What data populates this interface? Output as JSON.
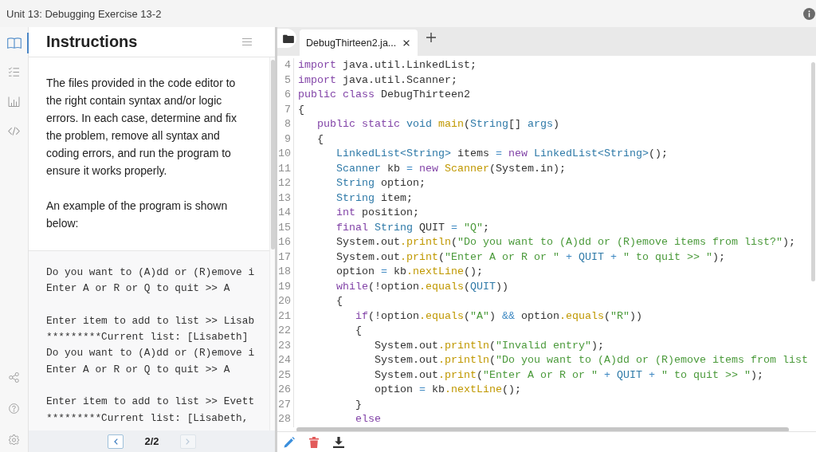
{
  "window": {
    "title": "Unit 13: Debugging Exercise 13-2"
  },
  "rail": {
    "items": [
      {
        "kind": "book",
        "selected": true
      },
      {
        "kind": "checklist",
        "selected": false
      },
      {
        "kind": "chart",
        "selected": false
      },
      {
        "kind": "code",
        "selected": false
      }
    ],
    "bottom_items": [
      {
        "kind": "share"
      },
      {
        "kind": "help"
      },
      {
        "kind": "settings"
      }
    ]
  },
  "instructions": {
    "title": "Instructions",
    "paragraphs": [
      "The files provided in the code editor to the right contain syntax and/or logic errors. In each case, determine and fix the problem, remove all syntax and coding errors, and run the program to ensure it works properly.",
      "An example of the program is shown below:"
    ],
    "example_output": [
      [
        "Do you want to (A)dd or (R)emove i",
        "Enter A or R or Q to quit >> A"
      ],
      [
        "Enter item to add to list >> Lisab",
        "*********Current list: [Lisabeth]",
        "Do you want to (A)dd or (R)emove i",
        "Enter A or R or Q to quit >> A"
      ],
      [
        "Enter item to add to list >> Evett",
        "*********Current list: [Lisabeth,"
      ]
    ],
    "pager": {
      "label": "2/2",
      "previous_disabled": false,
      "next_disabled": true
    }
  },
  "editor": {
    "tabs": [
      {
        "label": "DebugThirteen2.ja...",
        "selected": true
      }
    ],
    "lines": [
      {
        "number": "4",
        "tokens": [
          {
            "kind": "kw",
            "text": "import"
          },
          {
            "kind": "txt",
            "text": " java.util.LinkedList;"
          }
        ]
      },
      {
        "number": "5",
        "tokens": [
          {
            "kind": "kw",
            "text": "import"
          },
          {
            "kind": "txt",
            "text": " java.util.Scanner;"
          }
        ]
      },
      {
        "number": "6",
        "tokens": [
          {
            "kind": "kw",
            "text": "public"
          },
          {
            "kind": "kw",
            "text": " class"
          },
          {
            "kind": "txt",
            "text": " DebugThirteen2"
          }
        ]
      },
      {
        "number": "7",
        "tokens": [
          {
            "kind": "txt",
            "text": "{"
          }
        ],
        "children": [
          {
            "number": "8",
            "tokens": [
              {
                "kind": "kw",
                "text": "public"
              },
              {
                "kind": "kw",
                "text": " static"
              },
              {
                "kind": "type",
                "text": " void"
              },
              {
                "kind": "fn",
                "text": " main"
              },
              {
                "kind": "txt",
                "text": "("
              },
              {
                "kind": "type",
                "text": "String"
              },
              {
                "kind": "txt",
                "text": "[] "
              },
              {
                "kind": "type",
                "text": "args"
              },
              {
                "kind": "txt",
                "text": ")"
              }
            ]
          },
          {
            "number": "9",
            "tokens": [
              {
                "kind": "txt",
                "text": "{"
              }
            ],
            "children": [
              {
                "number": "10",
                "tokens": [
                  {
                    "kind": "type",
                    "text": "LinkedList<String>"
                  },
                  {
                    "kind": "txt",
                    "text": " items "
                  },
                  {
                    "kind": "op",
                    "text": "="
                  },
                  {
                    "kind": "kw",
                    "text": " new"
                  },
                  {
                    "kind": "type",
                    "text": " LinkedList<String>"
                  },
                  {
                    "kind": "txt",
                    "text": "();"
                  }
                ]
              },
              {
                "number": "11",
                "tokens": [
                  {
                    "kind": "type",
                    "text": "Scanner"
                  },
                  {
                    "kind": "txt",
                    "text": " kb "
                  },
                  {
                    "kind": "op",
                    "text": "="
                  },
                  {
                    "kind": "kw",
                    "text": " new"
                  },
                  {
                    "kind": "fn",
                    "text": " Scanner"
                  },
                  {
                    "kind": "txt",
                    "text": "(System.in);"
                  }
                ]
              },
              {
                "number": "12",
                "tokens": [
                  {
                    "kind": "type",
                    "text": "String"
                  },
                  {
                    "kind": "txt",
                    "text": " option;"
                  }
                ]
              },
              {
                "number": "13",
                "tokens": [
                  {
                    "kind": "type",
                    "text": "String"
                  },
                  {
                    "kind": "txt",
                    "text": " item;"
                  }
                ]
              },
              {
                "number": "14",
                "tokens": [
                  {
                    "kind": "kw",
                    "text": "int"
                  },
                  {
                    "kind": "txt",
                    "text": " position;"
                  }
                ]
              },
              {
                "number": "15",
                "tokens": [
                  {
                    "kind": "kw",
                    "text": "final"
                  },
                  {
                    "kind": "type",
                    "text": " String"
                  },
                  {
                    "kind": "txt",
                    "text": " QUIT "
                  },
                  {
                    "kind": "op",
                    "text": "="
                  },
                  {
                    "kind": "str",
                    "text": " \"Q\""
                  },
                  {
                    "kind": "txt",
                    "text": ";"
                  }
                ]
              },
              {
                "number": "16",
                "tokens": [
                  {
                    "kind": "txt",
                    "text": "System.out"
                  },
                  {
                    "kind": "fn",
                    "text": ".println"
                  },
                  {
                    "kind": "txt",
                    "text": "("
                  },
                  {
                    "kind": "str",
                    "text": "\"Do you want to (A)dd or (R)emove items from list?\""
                  },
                  {
                    "kind": "txt",
                    "text": ");"
                  }
                ]
              },
              {
                "number": "17",
                "tokens": [
                  {
                    "kind": "txt",
                    "text": "System.out"
                  },
                  {
                    "kind": "fn",
                    "text": ".print"
                  },
                  {
                    "kind": "txt",
                    "text": "("
                  },
                  {
                    "kind": "str",
                    "text": "\"Enter A or R or \""
                  },
                  {
                    "kind": "op",
                    "text": " +"
                  },
                  {
                    "kind": "type",
                    "text": " QUIT"
                  },
                  {
                    "kind": "op",
                    "text": " +"
                  },
                  {
                    "kind": "str",
                    "text": " \" to quit >> \""
                  },
                  {
                    "kind": "txt",
                    "text": ");"
                  }
                ]
              },
              {
                "number": "18",
                "tokens": [
                  {
                    "kind": "txt",
                    "text": "option "
                  },
                  {
                    "kind": "op",
                    "text": "="
                  },
                  {
                    "kind": "txt",
                    "text": " kb"
                  },
                  {
                    "kind": "fn",
                    "text": ".nextLine"
                  },
                  {
                    "kind": "txt",
                    "text": "();"
                  }
                ]
              },
              {
                "number": "19",
                "tokens": [
                  {
                    "kind": "kw",
                    "text": "while"
                  },
                  {
                    "kind": "txt",
                    "text": "(!option"
                  },
                  {
                    "kind": "fn",
                    "text": ".equals"
                  },
                  {
                    "kind": "txt",
                    "text": "("
                  },
                  {
                    "kind": "type",
                    "text": "QUIT"
                  },
                  {
                    "kind": "txt",
                    "text": "))"
                  }
                ]
              },
              {
                "number": "20",
                "tokens": [
                  {
                    "kind": "txt",
                    "text": "{"
                  }
                ],
                "children": [
                  {
                    "number": "21",
                    "tokens": [
                      {
                        "kind": "kw",
                        "text": "if"
                      },
                      {
                        "kind": "txt",
                        "text": "(!option"
                      },
                      {
                        "kind": "fn",
                        "text": ".equals"
                      },
                      {
                        "kind": "txt",
                        "text": "("
                      },
                      {
                        "kind": "str",
                        "text": "\"A\""
                      },
                      {
                        "kind": "txt",
                        "text": ") "
                      },
                      {
                        "kind": "op",
                        "text": "&&"
                      },
                      {
                        "kind": "txt",
                        "text": " option"
                      },
                      {
                        "kind": "fn",
                        "text": ".equals"
                      },
                      {
                        "kind": "txt",
                        "text": "("
                      },
                      {
                        "kind": "str",
                        "text": "\"R\""
                      },
                      {
                        "kind": "txt",
                        "text": "))"
                      }
                    ]
                  },
                  {
                    "number": "22",
                    "tokens": [
                      {
                        "kind": "txt",
                        "text": "{"
                      }
                    ],
                    "children": [
                      {
                        "number": "23",
                        "tokens": [
                          {
                            "kind": "txt",
                            "text": "System.out"
                          },
                          {
                            "kind": "fn",
                            "text": ".println"
                          },
                          {
                            "kind": "txt",
                            "text": "("
                          },
                          {
                            "kind": "str",
                            "text": "\"Invalid entry\""
                          },
                          {
                            "kind": "txt",
                            "text": ");"
                          }
                        ]
                      },
                      {
                        "number": "24",
                        "tokens": [
                          {
                            "kind": "txt",
                            "text": "System.out"
                          },
                          {
                            "kind": "fn",
                            "text": ".println"
                          },
                          {
                            "kind": "txt",
                            "text": "("
                          },
                          {
                            "kind": "str",
                            "text": "\"Do you want to (A)dd or (R)emove items from list"
                          }
                        ]
                      },
                      {
                        "number": "25",
                        "tokens": [
                          {
                            "kind": "txt",
                            "text": "System.out"
                          },
                          {
                            "kind": "fn",
                            "text": ".print"
                          },
                          {
                            "kind": "txt",
                            "text": "("
                          },
                          {
                            "kind": "str",
                            "text": "\"Enter A or R or \""
                          },
                          {
                            "kind": "op",
                            "text": " +"
                          },
                          {
                            "kind": "type",
                            "text": " QUIT"
                          },
                          {
                            "kind": "op",
                            "text": " +"
                          },
                          {
                            "kind": "str",
                            "text": " \" to quit >> \""
                          },
                          {
                            "kind": "txt",
                            "text": ");"
                          }
                        ]
                      },
                      {
                        "number": "26",
                        "tokens": [
                          {
                            "kind": "txt",
                            "text": "option "
                          },
                          {
                            "kind": "op",
                            "text": "="
                          },
                          {
                            "kind": "txt",
                            "text": " kb"
                          },
                          {
                            "kind": "fn",
                            "text": ".nextLine"
                          },
                          {
                            "kind": "txt",
                            "text": "();"
                          }
                        ]
                      }
                    ]
                  },
                  {
                    "number": "27",
                    "tokens": [
                      {
                        "kind": "txt",
                        "text": "}"
                      }
                    ]
                  },
                  {
                    "number": "28",
                    "tokens": [
                      {
                        "kind": "kw",
                        "text": "else"
                      }
                    ]
                  }
                ]
              }
            ]
          }
        ]
      }
    ],
    "toolbar": [
      {
        "kind": "edit"
      },
      {
        "kind": "delete"
      },
      {
        "kind": "download"
      }
    ]
  }
}
